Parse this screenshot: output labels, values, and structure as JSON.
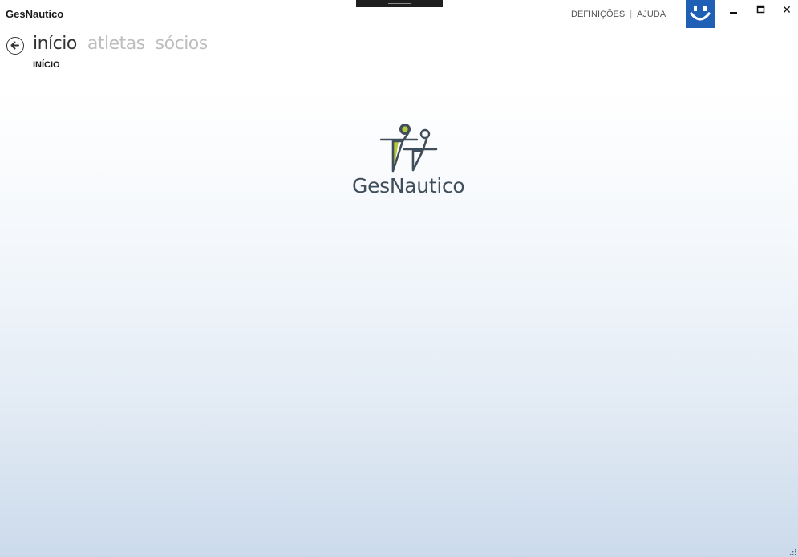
{
  "window": {
    "title": "GesNautico"
  },
  "top_links": {
    "settings": "DEFINIÇÕES",
    "separator": "|",
    "help": "AJUDA"
  },
  "window_controls": {
    "minimize_icon": "minimize-icon",
    "maximize_icon": "maximize-icon",
    "close_icon": "close-icon",
    "close_glyph": "✕"
  },
  "user_tile": {
    "icon": "smiley-icon",
    "color": "#1f5fb5"
  },
  "nav": {
    "tabs": [
      {
        "label": "início",
        "active": true
      },
      {
        "label": "atletas",
        "active": false
      },
      {
        "label": "sócios",
        "active": false
      }
    ]
  },
  "page": {
    "subtitle": "INÍCIO"
  },
  "logo": {
    "text": "GesNautico",
    "colors": {
      "primary": "#3f4e5a",
      "accent": "#b5c93a"
    }
  }
}
